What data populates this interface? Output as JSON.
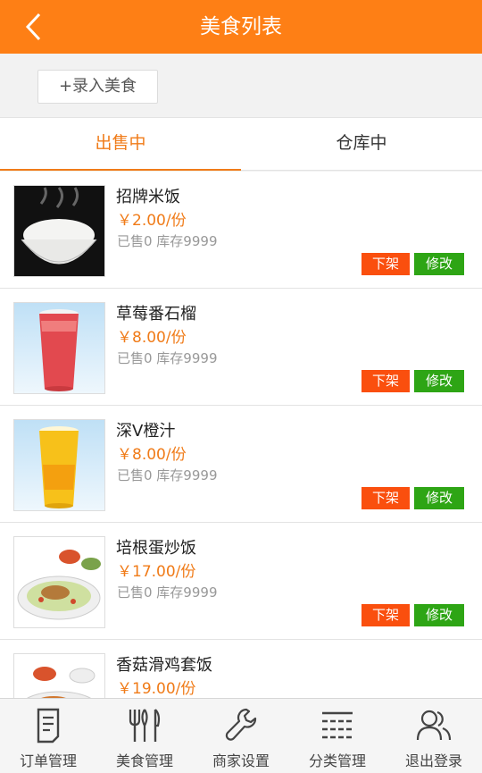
{
  "header": {
    "title": "美食列表",
    "back_icon": "chevron-left-icon"
  },
  "actions": {
    "add_label": "+录入美食"
  },
  "tabs": [
    {
      "label": "出售中",
      "active": true
    },
    {
      "label": "仓库中",
      "active": false
    }
  ],
  "items": [
    {
      "name": "招牌米饭",
      "price": "￥2.00/份",
      "stock": "已售0 库存9999",
      "off_label": "下架",
      "edit_label": "修改",
      "image": "rice-bowl"
    },
    {
      "name": "草莓番石榴",
      "price": "￥8.00/份",
      "stock": "已售0 库存9999",
      "off_label": "下架",
      "edit_label": "修改",
      "image": "red-drink"
    },
    {
      "name": "深V橙汁",
      "price": "￥8.00/份",
      "stock": "已售0 库存9999",
      "off_label": "下架",
      "edit_label": "修改",
      "image": "orange-drink"
    },
    {
      "name": "培根蛋炒饭",
      "price": "￥17.00/份",
      "stock": "已售0 库存9999",
      "off_label": "下架",
      "edit_label": "修改",
      "image": "fried-rice"
    },
    {
      "name": "香菇滑鸡套饭",
      "price": "￥19.00/份",
      "stock": "",
      "off_label": "",
      "edit_label": "",
      "image": "chicken-set"
    }
  ],
  "tabbar": [
    {
      "label": "订单管理",
      "icon": "order-document-icon"
    },
    {
      "label": "美食管理",
      "icon": "cutlery-icon"
    },
    {
      "label": "商家设置",
      "icon": "wrench-icon"
    },
    {
      "label": "分类管理",
      "icon": "category-list-icon"
    },
    {
      "label": "退出登录",
      "icon": "users-icon"
    }
  ],
  "colors": {
    "brand": "#fe7f15",
    "accent": "#f07b18",
    "off_button": "#fa4f0e",
    "edit_button": "#2ea515"
  }
}
